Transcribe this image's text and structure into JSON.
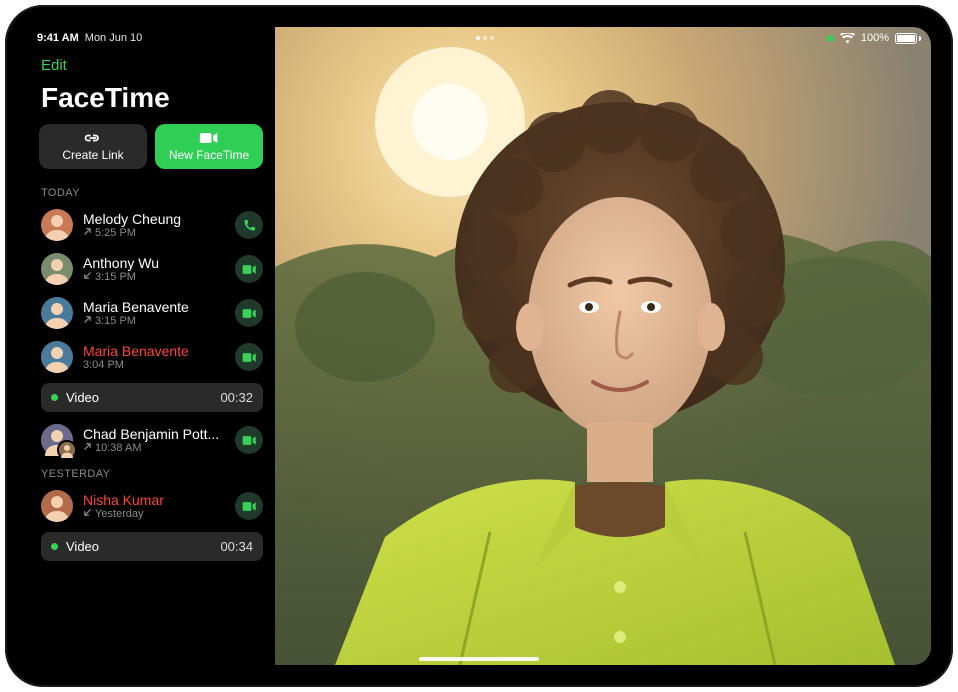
{
  "status": {
    "time": "9:41 AM",
    "date": "Mon Jun 10",
    "battery_pct": "100%"
  },
  "sidebar": {
    "edit": "Edit",
    "title": "FaceTime",
    "create_link": "Create Link",
    "new_facetime": "New FaceTime"
  },
  "sections": {
    "today": "TODAY",
    "yesterday": "YESTERDAY"
  },
  "calls": {
    "today": [
      {
        "name": "Melody Cheung",
        "time": "5:25 PM",
        "direction": "out",
        "missed": false,
        "action": "audio"
      },
      {
        "name": "Anthony Wu",
        "time": "3:15 PM",
        "direction": "in",
        "missed": false,
        "action": "video"
      },
      {
        "name": "Maria Benavente",
        "time": "3:15 PM",
        "direction": "out",
        "missed": false,
        "action": "video"
      },
      {
        "name": "Maria Benavente",
        "time": "3:04 PM",
        "direction": "",
        "missed": true,
        "action": "video",
        "voicemail": {
          "label": "Video",
          "duration": "00:32"
        }
      },
      {
        "name": "Chad Benjamin Pott...",
        "time": "10:38 AM",
        "direction": "out",
        "missed": false,
        "action": "video",
        "group": true
      }
    ],
    "yesterday": [
      {
        "name": "Nisha Kumar",
        "time": "Yesterday",
        "direction": "in",
        "missed": true,
        "action": "video",
        "voicemail": {
          "label": "Video",
          "duration": "00:34"
        }
      }
    ]
  }
}
